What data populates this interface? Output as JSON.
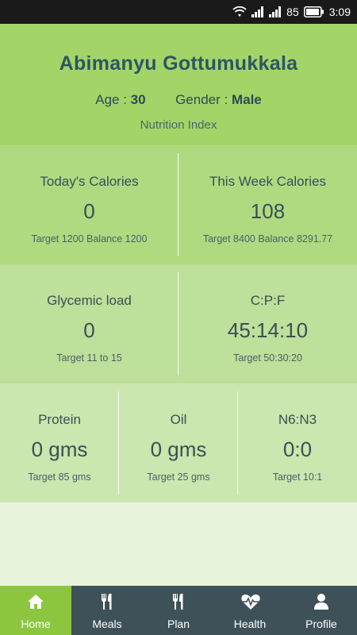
{
  "status_bar": {
    "battery": "85",
    "time": "3:09"
  },
  "profile": {
    "name": "Abimanyu Gottumukkala",
    "age_label": "Age :",
    "age": "30",
    "gender_label": "Gender :",
    "gender": "Male",
    "subtitle": "Nutrition Index"
  },
  "metrics": {
    "todays_calories": {
      "title": "Today's Calories",
      "value": "0",
      "target": "Target 1200 Balance 1200"
    },
    "week_calories": {
      "title": "This Week Calories",
      "value": "108",
      "target": "Target 8400 Balance 8291.77"
    },
    "glycemic": {
      "title": "Glycemic load",
      "value": "0",
      "target": "Target 11 to 15"
    },
    "cpf": {
      "title": "C:P:F",
      "value": "45:14:10",
      "target": "Target 50:30:20"
    },
    "protein": {
      "title": "Protein",
      "value": "0 gms",
      "target": "Target 85 gms"
    },
    "oil": {
      "title": "Oil",
      "value": "0 gms",
      "target": "Target 25 gms"
    },
    "n6n3": {
      "title": "N6:N3",
      "value": "0:0",
      "target": "Target 10:1"
    }
  },
  "nav": [
    {
      "label": "Home",
      "icon": "home-icon",
      "active": true
    },
    {
      "label": "Meals",
      "icon": "cutlery-icon"
    },
    {
      "label": "Plan",
      "icon": "cutlery-icon"
    },
    {
      "label": "Health",
      "icon": "heartbeat-icon"
    },
    {
      "label": "Profile",
      "icon": "user-icon"
    }
  ],
  "colors": {
    "header": "#a3d468",
    "row1": "#b0da80",
    "row2": "#bde09a",
    "row3": "#cbe6ae",
    "nav": "#3f5158",
    "nav_active": "#8cc63f"
  }
}
